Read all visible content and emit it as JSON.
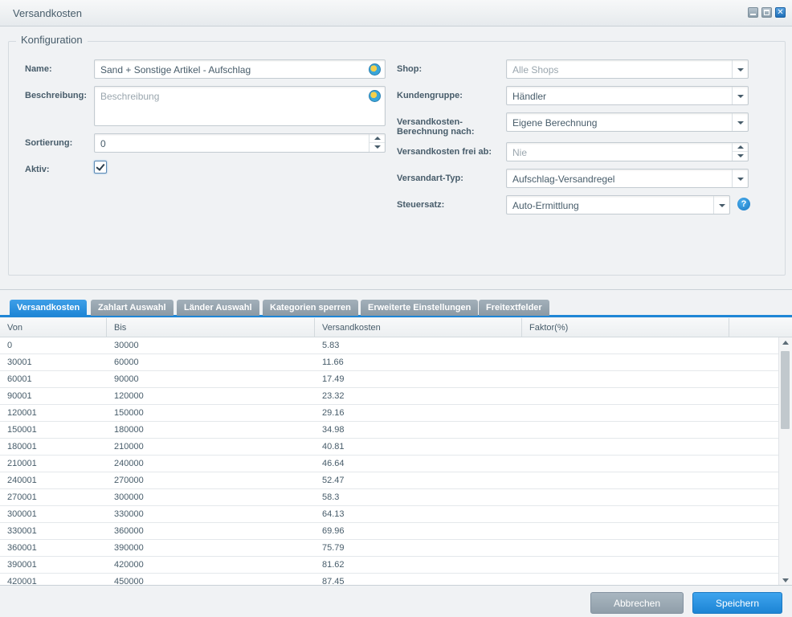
{
  "window": {
    "title": "Versandkosten"
  },
  "config": {
    "legend": "Konfiguration",
    "name_label": "Name:",
    "name_value": "Sand + Sonstige Artikel - Aufschlag",
    "beschreibung_label": "Beschreibung:",
    "beschreibung_placeholder": "Beschreibung",
    "sortierung_label": "Sortierung:",
    "sortierung_value": "0",
    "aktiv_label": "Aktiv:",
    "aktiv_checked": true,
    "shop_label": "Shop:",
    "shop_value": "Alle Shops",
    "kundengruppe_label": "Kundengruppe:",
    "kundengruppe_value": "Händler",
    "berechnung_label_1": "Versandkosten-",
    "berechnung_label_2": "Berechnung nach:",
    "berechnung_value": "Eigene Berechnung",
    "frei_label": "Versandkosten frei ab:",
    "frei_placeholder": "Nie",
    "typ_label": "Versandart-Typ:",
    "typ_value": "Aufschlag-Versandregel",
    "steuersatz_label": "Steuersatz:",
    "steuersatz_value": "Auto-Ermittlung"
  },
  "tabs": [
    "Versandkosten",
    "Zahlart Auswahl",
    "Länder Auswahl",
    "Kategorien sperren",
    "Erweiterte Einstellungen",
    "Freitextfelder"
  ],
  "grid": {
    "columns": [
      "Von",
      "Bis",
      "Versandkosten",
      "Faktor(%)"
    ],
    "rows": [
      [
        "0",
        "30000",
        "5.83",
        ""
      ],
      [
        "30001",
        "60000",
        "11.66",
        ""
      ],
      [
        "60001",
        "90000",
        "17.49",
        ""
      ],
      [
        "90001",
        "120000",
        "23.32",
        ""
      ],
      [
        "120001",
        "150000",
        "29.16",
        ""
      ],
      [
        "150001",
        "180000",
        "34.98",
        ""
      ],
      [
        "180001",
        "210000",
        "40.81",
        ""
      ],
      [
        "210001",
        "240000",
        "46.64",
        ""
      ],
      [
        "240001",
        "270000",
        "52.47",
        ""
      ],
      [
        "270001",
        "300000",
        "58.3",
        ""
      ],
      [
        "300001",
        "330000",
        "64.13",
        ""
      ],
      [
        "330001",
        "360000",
        "69.96",
        ""
      ],
      [
        "360001",
        "390000",
        "75.79",
        ""
      ],
      [
        "390001",
        "420000",
        "81.62",
        ""
      ],
      [
        "420001",
        "450000",
        "87.45",
        ""
      ]
    ]
  },
  "footer": {
    "cancel_label": "Abbrechen",
    "save_label": "Speichern"
  }
}
